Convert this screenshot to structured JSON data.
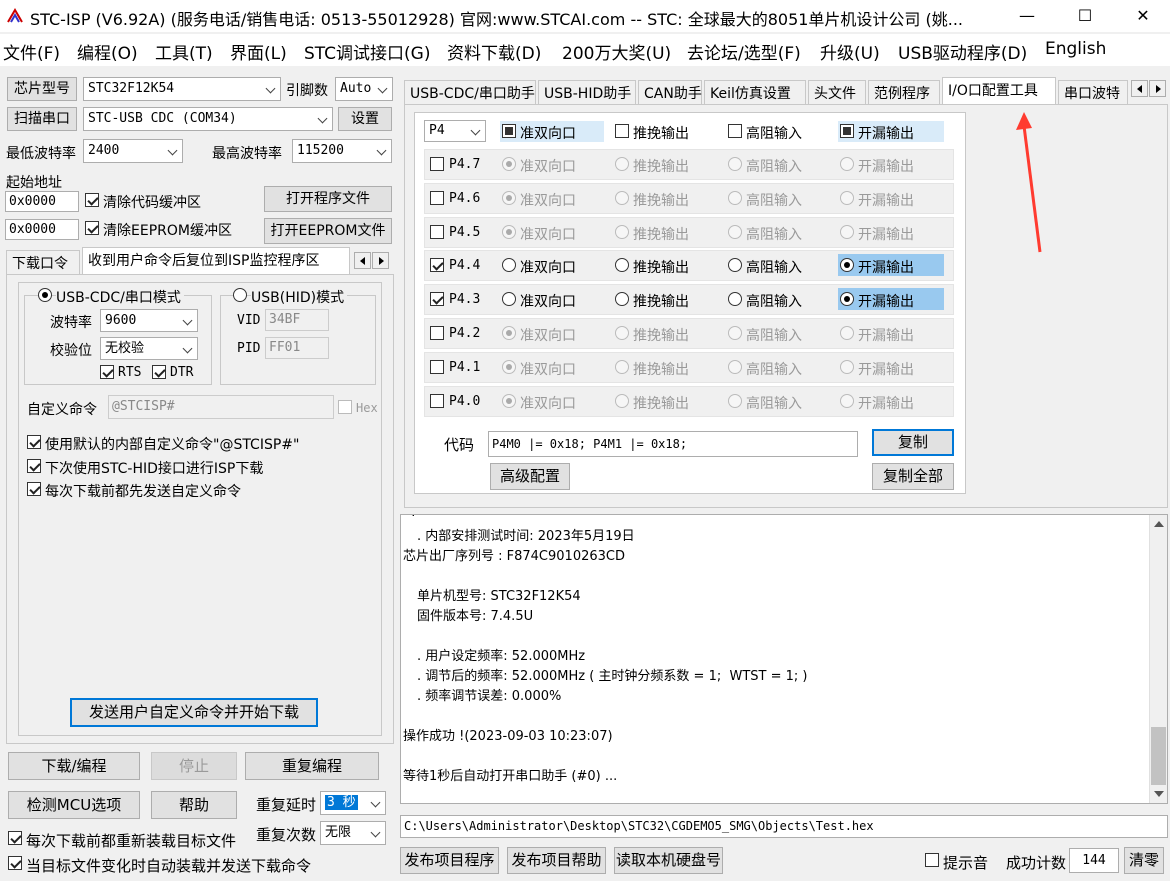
{
  "title": "STC-ISP (V6.92A) (服务电话/销售电话: 0513-55012928) 官网:www.STCAI.com  -- STC: 全球最大的8051单片机设计公司 (姚...",
  "window_controls": [
    "—",
    "☐",
    "✕"
  ],
  "menu": [
    "文件(F)",
    "编程(O)",
    "工具(T)",
    "界面(L)",
    "STC调试接口(G)",
    "资料下载(D)",
    "200万大奖(U)",
    "去论坛/选型(F)",
    "升级(U)",
    "USB驱动程序(D)",
    "English"
  ],
  "left": {
    "chip_btn": "芯片型号",
    "chip_value": "STC32F12K54",
    "pins_label": "引脚数",
    "pins_value": "Auto",
    "scan_btn": "扫描串口",
    "port_value": "STC-USB CDC (COM34)",
    "settings_btn": "设置",
    "min_baud_label": "最低波特率",
    "min_baud": "2400",
    "max_baud_label": "最高波特率",
    "max_baud": "115200",
    "start_addr_label": "起始地址",
    "addr1": "0x0000",
    "clear_code": "清除代码缓冲区",
    "open_prog": "打开程序文件",
    "addr2": "0x0000",
    "clear_eeprom": "清除EEPROM缓冲区",
    "open_eeprom": "打开EEPROM文件",
    "tabs": [
      "下载口令",
      "收到用户命令后复位到ISP监控程序区"
    ],
    "usb_cdc_mode": "USB-CDC/串口模式",
    "usb_hid_mode": "USB(HID)模式",
    "baud_label": "波特率",
    "baud_value": "9600",
    "parity_label": "校验位",
    "parity_value": "无校验",
    "vid_label": "VID",
    "vid_value": "34BF",
    "pid_label": "PID",
    "pid_value": "FF01",
    "rts": "RTS",
    "dtr": "DTR",
    "custom_cmd_label": "自定义命令",
    "custom_cmd_value": "@STCISP#",
    "hex_label": "Hex",
    "opt1": "使用默认的内部自定义命令\"@STCISP#\"",
    "opt2": "下次使用STC-HID接口进行ISP下载",
    "opt3": "每次下载前都先发送自定义命令",
    "send_btn": "发送用户自定义命令并开始下载",
    "download_btn": "下载/编程",
    "stop_btn": "停止",
    "reprog_btn": "重复编程",
    "check_mcu_btn": "检测MCU选项",
    "help_btn": "帮助",
    "repeat_delay_label": "重复延时",
    "repeat_delay_value": "3 秒",
    "repeat_count_label": "重复次数",
    "repeat_count_value": "无限",
    "reload_opt": "每次下载前都重新装载目标文件",
    "auto_opt": "当目标文件变化时自动装载并发送下载命令"
  },
  "right": {
    "tabs": [
      "USB-CDC/串口助手",
      "USB-HID助手",
      "CAN助手",
      "Keil仿真设置",
      "头文件",
      "范例程序",
      "I/O口配置工具",
      "串口波特"
    ],
    "port_select": "P4",
    "modes": [
      "准双向口",
      "推挽输出",
      "高阻输入",
      "开漏输出"
    ],
    "pins": [
      {
        "name": "P4.7",
        "checked": false,
        "mode": 0
      },
      {
        "name": "P4.6",
        "checked": false,
        "mode": 0
      },
      {
        "name": "P4.5",
        "checked": false,
        "mode": 0
      },
      {
        "name": "P4.4",
        "checked": true,
        "mode": 3
      },
      {
        "name": "P4.3",
        "checked": true,
        "mode": 3
      },
      {
        "name": "P4.2",
        "checked": false,
        "mode": 0
      },
      {
        "name": "P4.1",
        "checked": false,
        "mode": 0
      },
      {
        "name": "P4.0",
        "checked": false,
        "mode": 0
      }
    ],
    "code_label": "代码",
    "code_value": "P4M0  |= 0x18;  P4M1  |= 0x18;",
    "copy_btn": "复制",
    "advanced_btn": "高级配置",
    "copy_all_btn": "复制全部"
  },
  "log": [
    ". 内部安排测试时间: 2023年5月19日",
    "芯片出厂序列号 : F874C9010263CD",
    "",
    "单片机型号: STC32F12K54",
    "固件版本号: 7.4.5U",
    "",
    ". 用户设定频率: 52.000MHz",
    ". 调节后的频率: 52.000MHz ( 主时钟分频系数 = 1;  WTST = 1; )",
    ". 频率调节误差: 0.000%",
    "",
    "操作成功 !(2023-09-03 10:23:07)",
    "",
    "等待1秒后自动打开串口助手 (#0) ..."
  ],
  "filepath": "C:\\Users\\Administrator\\Desktop\\STC32\\CGDEMO5_SMG\\Objects\\Test.hex",
  "bottom": {
    "publish_btn": "发布项目程序",
    "publish_help_btn": "发布项目帮助",
    "read_disk_btn": "读取本机硬盘号",
    "beep_label": "提示音",
    "success_label": "成功计数",
    "success_count": "144",
    "clear_btn": "清零"
  },
  "colors": {
    "accent": "#0078d7",
    "arrow": "#ff3b30",
    "highlight": "#99c9ef"
  }
}
